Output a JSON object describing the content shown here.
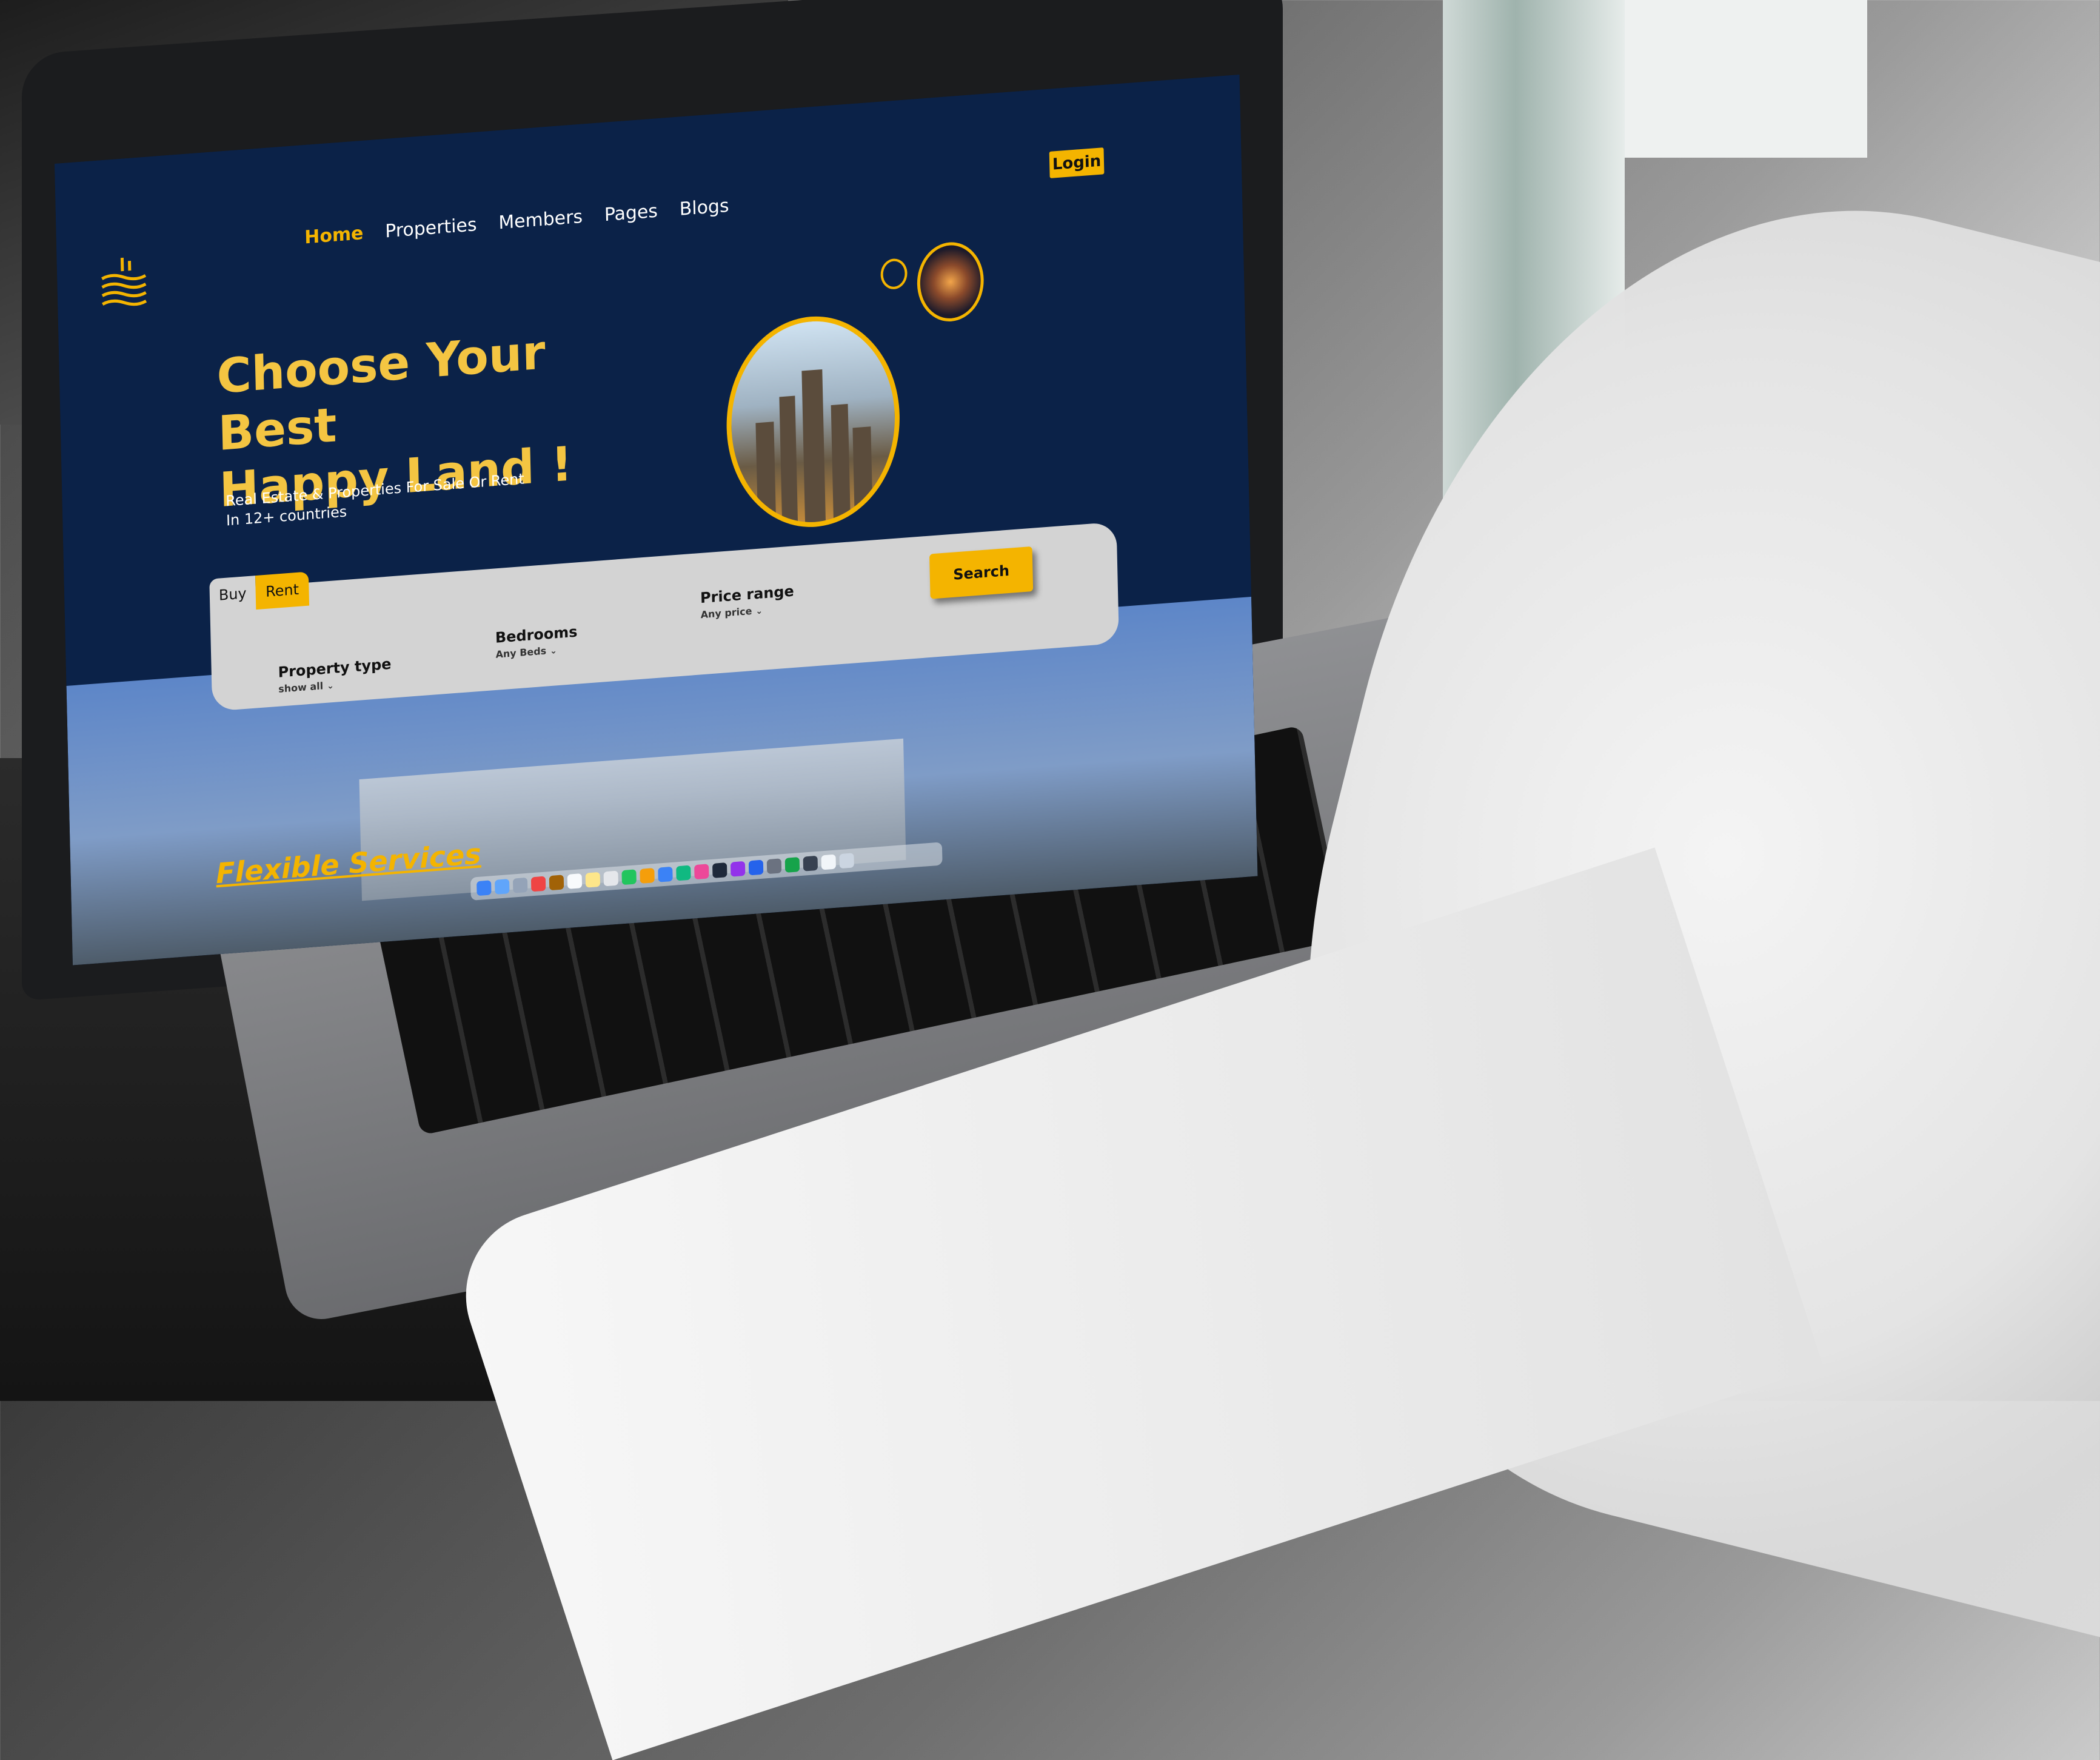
{
  "colors": {
    "navy": "#0b2248",
    "accent": "#f4b400",
    "panel": "#d3d3d3"
  },
  "header": {
    "logo_icon": "stacked-waves-logo-icon",
    "nav": [
      {
        "label": "Home",
        "active": true
      },
      {
        "label": "Properties",
        "active": false
      },
      {
        "label": "Members",
        "active": false
      },
      {
        "label": "Pages",
        "active": false
      },
      {
        "label": "Blogs",
        "active": false
      }
    ],
    "login_label": "Login"
  },
  "hero": {
    "title_line1": "Choose Your Best",
    "title_line2": "Happy Land !",
    "subtitle_line1": "Real Estate & Properties For Sale Or Rent",
    "subtitle_line2": "In 12+ countries"
  },
  "search": {
    "tabs": [
      {
        "label": "Buy",
        "active": false
      },
      {
        "label": "Rent",
        "active": true
      }
    ],
    "fields": {
      "property_type": {
        "label": "Property type",
        "value": "show all"
      },
      "bedrooms": {
        "label": "Bedrooms",
        "value": "Any Beds"
      },
      "price_range": {
        "label": "Price range",
        "value": "Any price"
      }
    },
    "button_label": "Search"
  },
  "section": {
    "title": "Flexible Services"
  }
}
